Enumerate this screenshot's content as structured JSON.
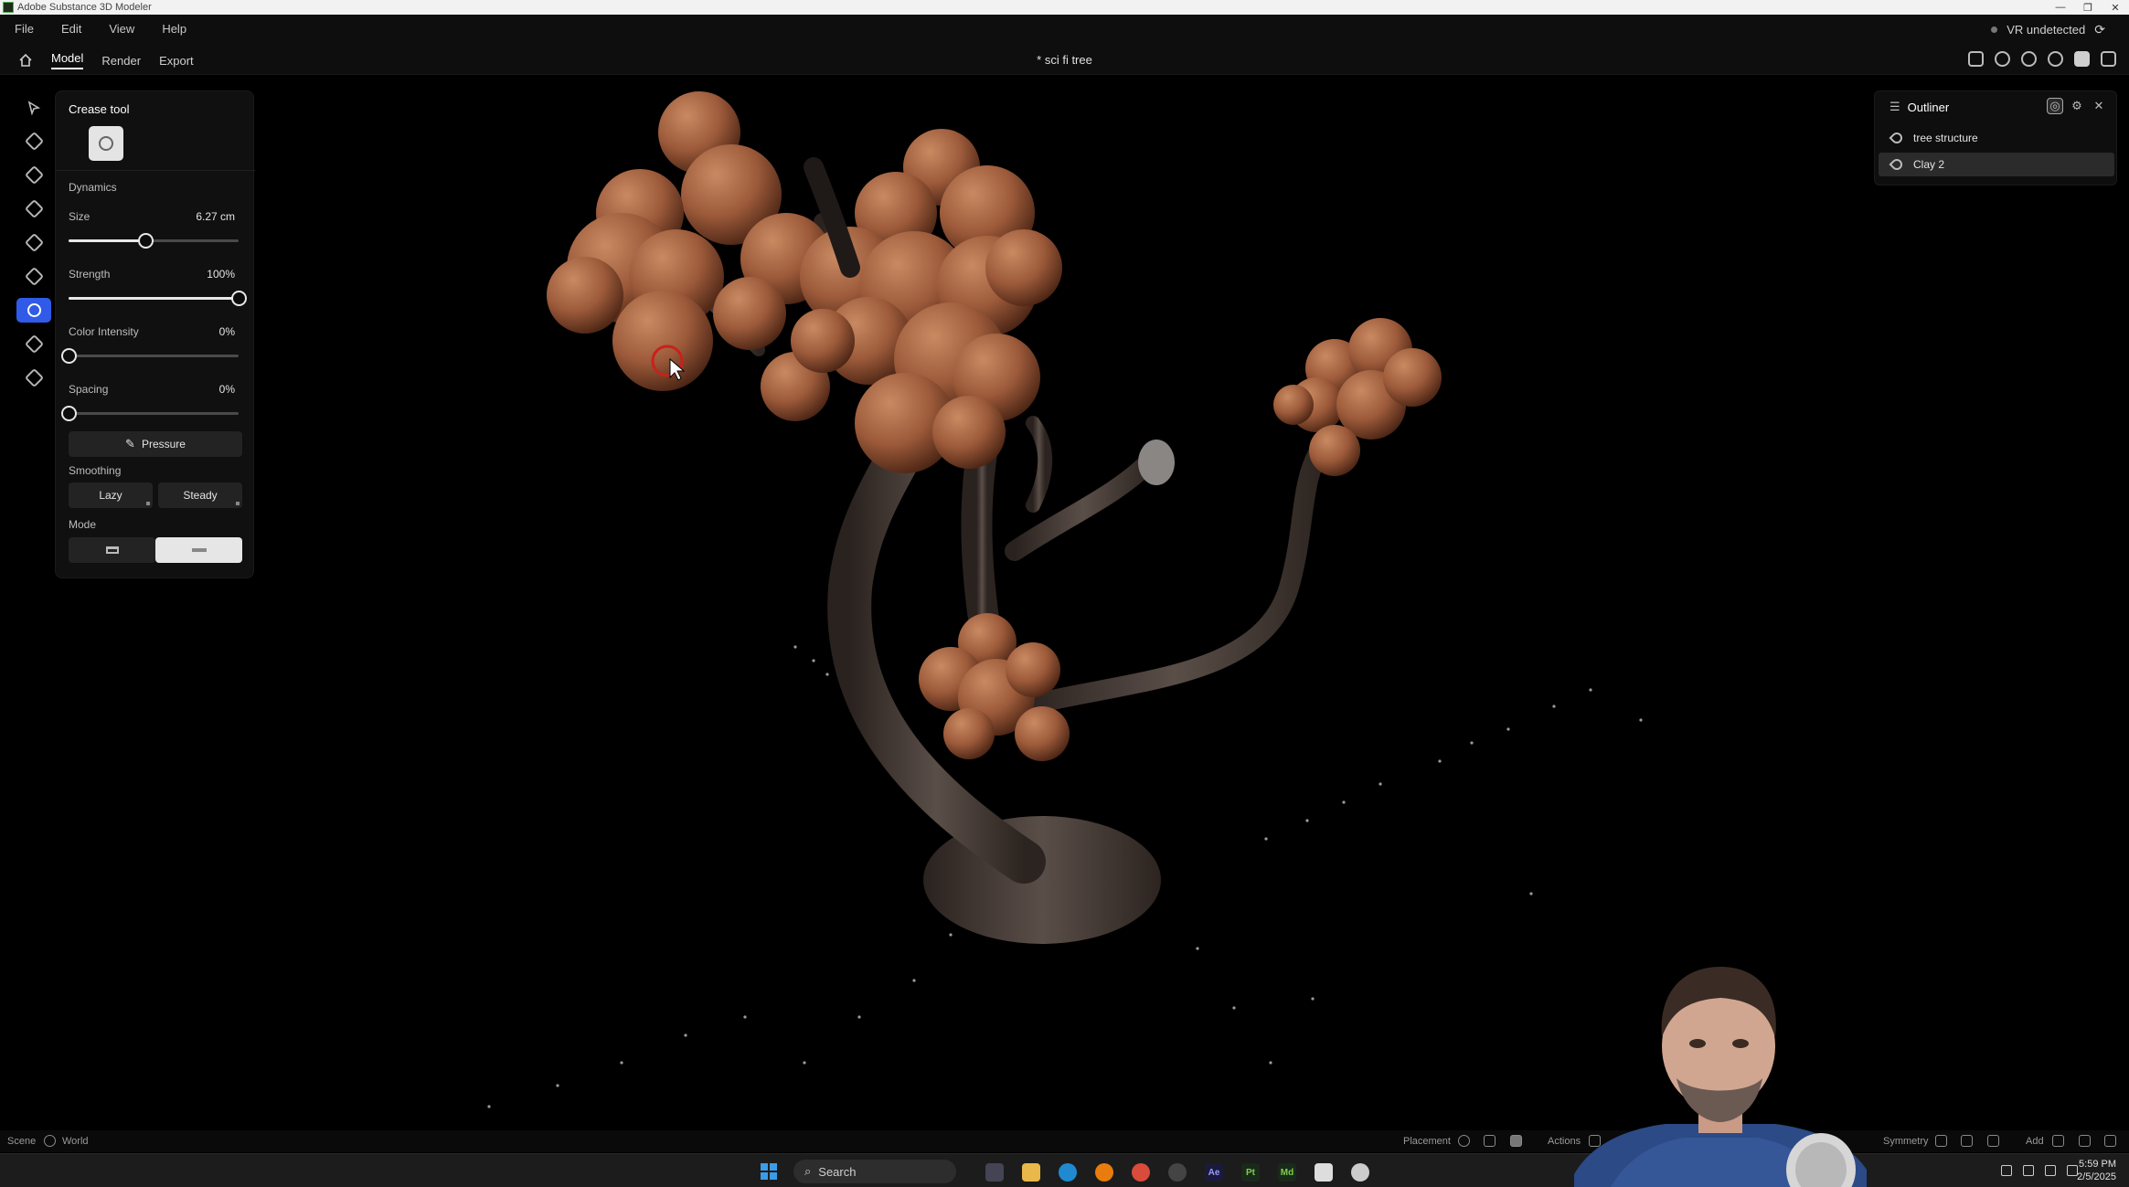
{
  "window": {
    "title": "Adobe Substance 3D Modeler",
    "controls": [
      "—",
      "❐",
      "✕"
    ]
  },
  "menu": [
    "File",
    "Edit",
    "View",
    "Help"
  ],
  "header": {
    "vr_status": "VR undetected",
    "tabs": [
      "Model",
      "Render",
      "Export"
    ],
    "active_tab": "Model",
    "document_title": "* sci fi tree"
  },
  "tools": [
    {
      "icon": "select-icon"
    },
    {
      "icon": "brush-icon"
    },
    {
      "icon": "erase-icon"
    },
    {
      "icon": "smooth-icon"
    },
    {
      "icon": "inflate-icon"
    },
    {
      "icon": "move-icon"
    },
    {
      "icon": "crease-icon",
      "active": true
    },
    {
      "icon": "flatten-icon"
    },
    {
      "icon": "paint-icon"
    }
  ],
  "tool_panel": {
    "title": "Crease tool",
    "section_dynamics": "Dynamics",
    "size": {
      "label": "Size",
      "value": "6.27 cm",
      "level": 0.45
    },
    "strength": {
      "label": "Strength",
      "value": "100%",
      "level": 1.0
    },
    "color_intensity": {
      "label": "Color Intensity",
      "value": "0%",
      "level": 0.0
    },
    "spacing": {
      "label": "Spacing",
      "value": "0%",
      "level": 0.0
    },
    "pressure_label": "Pressure",
    "section_smoothing": "Smoothing",
    "lazy_label": "Lazy",
    "steady_label": "Steady",
    "section_mode": "Mode"
  },
  "outliner": {
    "title": "Outliner",
    "items": [
      {
        "label": "tree structure",
        "selected": false
      },
      {
        "label": "Clay 2",
        "selected": true
      }
    ]
  },
  "status_bar": {
    "scene": "Scene",
    "world": "World",
    "placement": "Placement",
    "actions": "Actions",
    "symmetry": "Symmetry",
    "add": "Add"
  },
  "taskbar": {
    "search": "Search",
    "apps": [
      "Ae",
      "Pt",
      "Md"
    ],
    "time": "5:59 PM",
    "date": "2/5/2025"
  },
  "colors": {
    "accent": "#2f5be8",
    "clay": "#9c5a3a",
    "trunk": "#4a3f3a",
    "panel": "#101010"
  }
}
